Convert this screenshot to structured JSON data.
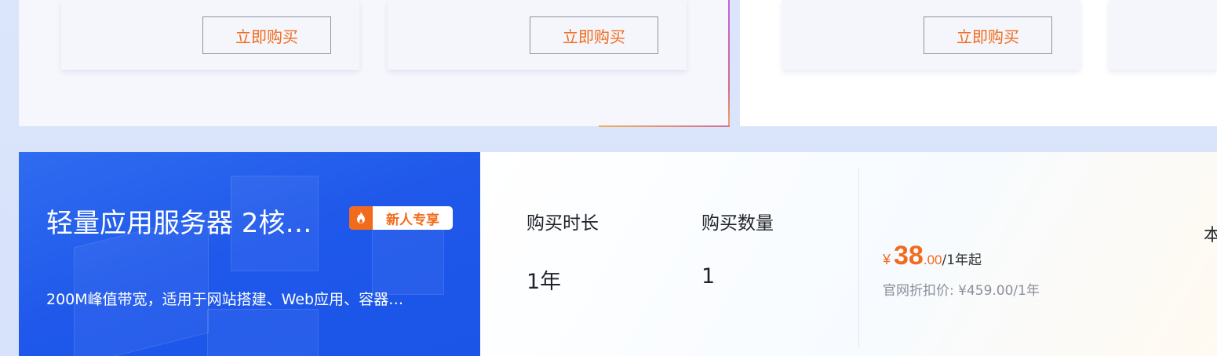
{
  "cards": [
    {
      "buy_label": "立即购买"
    },
    {
      "buy_label": "立即购买"
    },
    {
      "buy_label": "立即购买"
    }
  ],
  "product": {
    "title": "轻量应用服务器 2核…",
    "badge": "新人专享",
    "badge_icon": "flame-icon",
    "description": "200M峰值带宽，适用于网站搭建、Web应用、容器…"
  },
  "purchase": {
    "duration_label": "购买时长",
    "duration_value": "1年",
    "quantity_label": "购买数量",
    "quantity_value": "1"
  },
  "price": {
    "currency": "¥",
    "integer": "38",
    "decimal": ".00",
    "unit": "/1年起",
    "original": "官网折扣价: ¥459.00/1年"
  },
  "edge_text": "本",
  "colors": {
    "accent": "#f26b1d",
    "banner_blue": "#1f58ea"
  }
}
